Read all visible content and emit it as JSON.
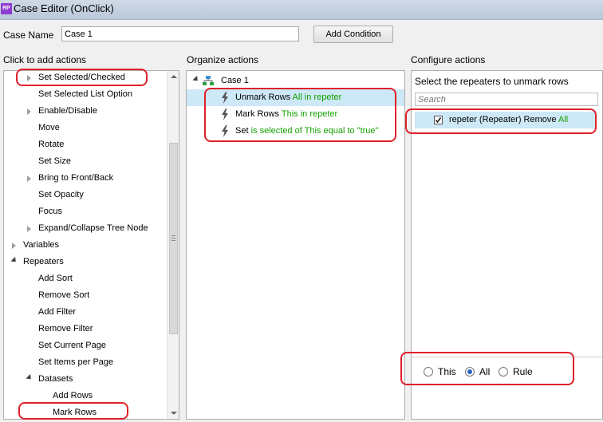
{
  "window": {
    "title": "Case Editor (OnClick)",
    "app_icon": "RP"
  },
  "case_name": {
    "label": "Case Name",
    "value": "Case 1",
    "add_condition": "Add Condition"
  },
  "left": {
    "header": "Click to add actions",
    "items": [
      {
        "label": "Set Selected/Checked",
        "expander": "collapsed"
      },
      {
        "label": "Set Selected List Option",
        "expander": "none"
      },
      {
        "label": "Enable/Disable",
        "expander": "collapsed"
      },
      {
        "label": "Move",
        "expander": "none"
      },
      {
        "label": "Rotate",
        "expander": "none"
      },
      {
        "label": "Set Size",
        "expander": "none"
      },
      {
        "label": "Bring to Front/Back",
        "expander": "collapsed"
      },
      {
        "label": "Set Opacity",
        "expander": "none"
      },
      {
        "label": "Focus",
        "expander": "none"
      },
      {
        "label": "Expand/Collapse Tree Node",
        "expander": "collapsed"
      },
      {
        "label": "Variables",
        "expander": "collapsed"
      },
      {
        "label": "Repeaters",
        "expander": "expanded"
      },
      {
        "label": "Add Sort",
        "expander": "none"
      },
      {
        "label": "Remove Sort",
        "expander": "none"
      },
      {
        "label": "Add Filter",
        "expander": "none"
      },
      {
        "label": "Remove Filter",
        "expander": "none"
      },
      {
        "label": "Set Current Page",
        "expander": "none"
      },
      {
        "label": "Set Items per Page",
        "expander": "none"
      },
      {
        "label": "Datasets",
        "expander": "expanded"
      },
      {
        "label": "Add Rows",
        "expander": "none"
      },
      {
        "label": "Mark Rows",
        "expander": "none"
      }
    ]
  },
  "middle": {
    "header": "Organize actions",
    "case_label": "Case 1",
    "actions": [
      {
        "action": "Unmark Rows",
        "detail": "All in repeter",
        "selected": true
      },
      {
        "action": "Mark Rows",
        "detail": "This in repeter",
        "selected": false
      },
      {
        "action": "Set",
        "detail": "is selected of This equal to \"true\"",
        "selected": false
      }
    ]
  },
  "right": {
    "header": "Configure actions",
    "instruction": "Select the repeaters to unmark rows",
    "search_placeholder": "Search",
    "repeater_item": {
      "name": "repeter (Repeater) Remove",
      "mode": "All",
      "checked": true
    },
    "radios": [
      {
        "label": "This",
        "selected": false
      },
      {
        "label": "All",
        "selected": true
      },
      {
        "label": "Rule",
        "selected": false
      }
    ]
  },
  "colors": {
    "highlight": "#cde8f6",
    "detail_green": "#13a000",
    "annotation_red": "#e0202a"
  }
}
